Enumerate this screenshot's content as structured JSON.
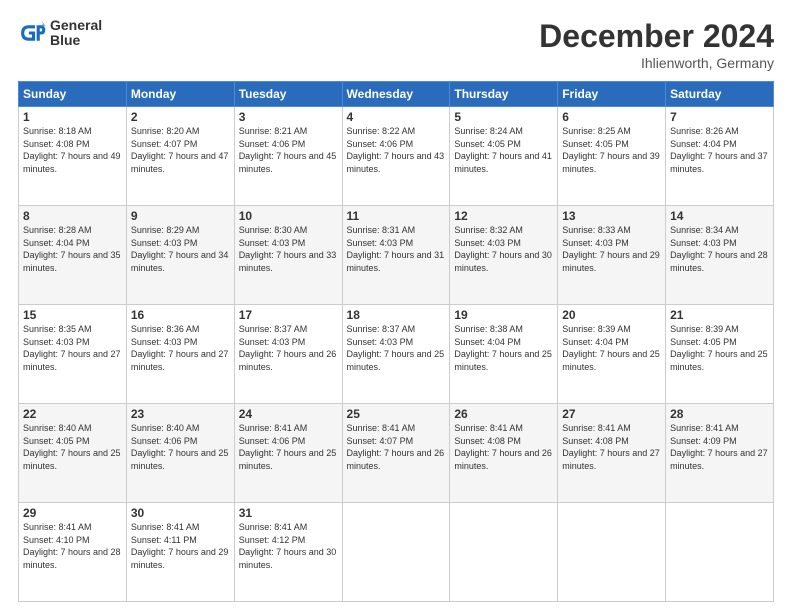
{
  "logo": {
    "line1": "General",
    "line2": "Blue"
  },
  "title": "December 2024",
  "location": "Ihlienworth, Germany",
  "headers": [
    "Sunday",
    "Monday",
    "Tuesday",
    "Wednesday",
    "Thursday",
    "Friday",
    "Saturday"
  ],
  "weeks": [
    [
      {
        "day": "1",
        "sunrise": "8:18 AM",
        "sunset": "4:08 PM",
        "daylight": "7 hours and 49 minutes."
      },
      {
        "day": "2",
        "sunrise": "8:20 AM",
        "sunset": "4:07 PM",
        "daylight": "7 hours and 47 minutes."
      },
      {
        "day": "3",
        "sunrise": "8:21 AM",
        "sunset": "4:06 PM",
        "daylight": "7 hours and 45 minutes."
      },
      {
        "day": "4",
        "sunrise": "8:22 AM",
        "sunset": "4:06 PM",
        "daylight": "7 hours and 43 minutes."
      },
      {
        "day": "5",
        "sunrise": "8:24 AM",
        "sunset": "4:05 PM",
        "daylight": "7 hours and 41 minutes."
      },
      {
        "day": "6",
        "sunrise": "8:25 AM",
        "sunset": "4:05 PM",
        "daylight": "7 hours and 39 minutes."
      },
      {
        "day": "7",
        "sunrise": "8:26 AM",
        "sunset": "4:04 PM",
        "daylight": "7 hours and 37 minutes."
      }
    ],
    [
      {
        "day": "8",
        "sunrise": "8:28 AM",
        "sunset": "4:04 PM",
        "daylight": "7 hours and 35 minutes."
      },
      {
        "day": "9",
        "sunrise": "8:29 AM",
        "sunset": "4:03 PM",
        "daylight": "7 hours and 34 minutes."
      },
      {
        "day": "10",
        "sunrise": "8:30 AM",
        "sunset": "4:03 PM",
        "daylight": "7 hours and 33 minutes."
      },
      {
        "day": "11",
        "sunrise": "8:31 AM",
        "sunset": "4:03 PM",
        "daylight": "7 hours and 31 minutes."
      },
      {
        "day": "12",
        "sunrise": "8:32 AM",
        "sunset": "4:03 PM",
        "daylight": "7 hours and 30 minutes."
      },
      {
        "day": "13",
        "sunrise": "8:33 AM",
        "sunset": "4:03 PM",
        "daylight": "7 hours and 29 minutes."
      },
      {
        "day": "14",
        "sunrise": "8:34 AM",
        "sunset": "4:03 PM",
        "daylight": "7 hours and 28 minutes."
      }
    ],
    [
      {
        "day": "15",
        "sunrise": "8:35 AM",
        "sunset": "4:03 PM",
        "daylight": "7 hours and 27 minutes."
      },
      {
        "day": "16",
        "sunrise": "8:36 AM",
        "sunset": "4:03 PM",
        "daylight": "7 hours and 27 minutes."
      },
      {
        "day": "17",
        "sunrise": "8:37 AM",
        "sunset": "4:03 PM",
        "daylight": "7 hours and 26 minutes."
      },
      {
        "day": "18",
        "sunrise": "8:37 AM",
        "sunset": "4:03 PM",
        "daylight": "7 hours and 25 minutes."
      },
      {
        "day": "19",
        "sunrise": "8:38 AM",
        "sunset": "4:04 PM",
        "daylight": "7 hours and 25 minutes."
      },
      {
        "day": "20",
        "sunrise": "8:39 AM",
        "sunset": "4:04 PM",
        "daylight": "7 hours and 25 minutes."
      },
      {
        "day": "21",
        "sunrise": "8:39 AM",
        "sunset": "4:05 PM",
        "daylight": "7 hours and 25 minutes."
      }
    ],
    [
      {
        "day": "22",
        "sunrise": "8:40 AM",
        "sunset": "4:05 PM",
        "daylight": "7 hours and 25 minutes."
      },
      {
        "day": "23",
        "sunrise": "8:40 AM",
        "sunset": "4:06 PM",
        "daylight": "7 hours and 25 minutes."
      },
      {
        "day": "24",
        "sunrise": "8:41 AM",
        "sunset": "4:06 PM",
        "daylight": "7 hours and 25 minutes."
      },
      {
        "day": "25",
        "sunrise": "8:41 AM",
        "sunset": "4:07 PM",
        "daylight": "7 hours and 26 minutes."
      },
      {
        "day": "26",
        "sunrise": "8:41 AM",
        "sunset": "4:08 PM",
        "daylight": "7 hours and 26 minutes."
      },
      {
        "day": "27",
        "sunrise": "8:41 AM",
        "sunset": "4:08 PM",
        "daylight": "7 hours and 27 minutes."
      },
      {
        "day": "28",
        "sunrise": "8:41 AM",
        "sunset": "4:09 PM",
        "daylight": "7 hours and 27 minutes."
      }
    ],
    [
      {
        "day": "29",
        "sunrise": "8:41 AM",
        "sunset": "4:10 PM",
        "daylight": "7 hours and 28 minutes."
      },
      {
        "day": "30",
        "sunrise": "8:41 AM",
        "sunset": "4:11 PM",
        "daylight": "7 hours and 29 minutes."
      },
      {
        "day": "31",
        "sunrise": "8:41 AM",
        "sunset": "4:12 PM",
        "daylight": "7 hours and 30 minutes."
      },
      null,
      null,
      null,
      null
    ]
  ]
}
